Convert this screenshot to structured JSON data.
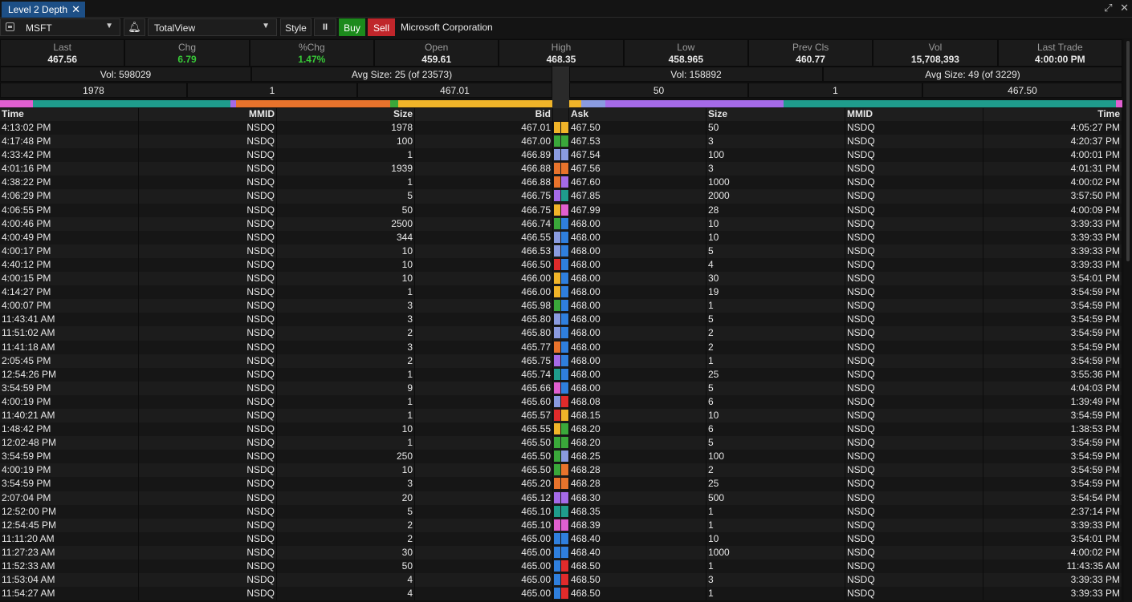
{
  "tab": {
    "title": "Level 2 Depth"
  },
  "toolbar": {
    "symbol": "MSFT",
    "view": "TotalView",
    "style": "Style",
    "pause": "II",
    "buy": "Buy",
    "sell": "Sell",
    "company": "Microsoft Corporation"
  },
  "summary": [
    {
      "label": "Last",
      "value": "467.56",
      "color": ""
    },
    {
      "label": "Chg",
      "value": "6.79",
      "color": "#37c837"
    },
    {
      "label": "%Chg",
      "value": "1.47%",
      "color": "#37c837"
    },
    {
      "label": "Open",
      "value": "459.61",
      "color": ""
    },
    {
      "label": "High",
      "value": "468.35",
      "color": ""
    },
    {
      "label": "Low",
      "value": "458.965",
      "color": ""
    },
    {
      "label": "Prev Cls",
      "value": "460.77",
      "color": ""
    },
    {
      "label": "Vol",
      "value": "15,708,393",
      "color": ""
    },
    {
      "label": "Last Trade",
      "value": "4:00:00 PM",
      "color": ""
    }
  ],
  "bid_side": {
    "vol": "Vol: 598029",
    "avg": "Avg Size: 25 (of 23573)",
    "top": [
      "1978",
      "1",
      "467.01"
    ]
  },
  "ask_side": {
    "vol": "Vol: 158892",
    "avg": "Avg Size: 49 (of 3229)",
    "top": [
      "50",
      "1",
      "467.50"
    ]
  },
  "colors": {
    "orange": "#e8732c",
    "yellow": "#f0b429",
    "green": "#3aa83a",
    "lav": "#8a9be0",
    "purple": "#a56ae8",
    "teal": "#1f9c8c",
    "pink": "#e05fd0",
    "blue": "#2f7fdd",
    "red": "#e02b2b"
  },
  "bid_bar": [
    [
      "pink",
      3
    ],
    [
      "teal",
      18
    ],
    [
      "purple",
      0.5
    ],
    [
      "orange",
      14
    ],
    [
      "green",
      0.8
    ],
    [
      "yellow",
      14
    ]
  ],
  "ask_bar": [
    [
      "yellow",
      1.5
    ],
    [
      "lav",
      3
    ],
    [
      "purple",
      22
    ],
    [
      "teal",
      41
    ],
    [
      "pink",
      0.8
    ]
  ],
  "headers": {
    "time": "Time",
    "mmid": "MMID",
    "size": "Size",
    "bid": "Bid",
    "ask": "Ask"
  },
  "bids": [
    [
      "4:13:02 PM",
      "NSDQ",
      "1978",
      "467.01",
      "yellow"
    ],
    [
      "4:17:48 PM",
      "NSDQ",
      "100",
      "467.00",
      "green"
    ],
    [
      "4:33:42 PM",
      "NSDQ",
      "1",
      "466.89",
      "lav"
    ],
    [
      "4:01:16 PM",
      "NSDQ",
      "1939",
      "466.88",
      "orange"
    ],
    [
      "4:38:22 PM",
      "NSDQ",
      "1",
      "466.88",
      "orange"
    ],
    [
      "4:06:29 PM",
      "NSDQ",
      "5",
      "466.75",
      "purple"
    ],
    [
      "4:06:55 PM",
      "NSDQ",
      "50",
      "466.75",
      "yellow"
    ],
    [
      "4:00:46 PM",
      "NSDQ",
      "2500",
      "466.74",
      "green"
    ],
    [
      "4:00:49 PM",
      "NSDQ",
      "344",
      "466.55",
      "lav"
    ],
    [
      "4:00:17 PM",
      "NSDQ",
      "10",
      "466.53",
      "lav"
    ],
    [
      "4:40:12 PM",
      "NSDQ",
      "10",
      "466.50",
      "red"
    ],
    [
      "4:00:15 PM",
      "NSDQ",
      "10",
      "466.00",
      "yellow"
    ],
    [
      "4:14:27 PM",
      "NSDQ",
      "1",
      "466.00",
      "yellow"
    ],
    [
      "4:00:07 PM",
      "NSDQ",
      "3",
      "465.98",
      "green"
    ],
    [
      "11:43:41 AM",
      "NSDQ",
      "3",
      "465.80",
      "lav"
    ],
    [
      "11:51:02 AM",
      "NSDQ",
      "2",
      "465.80",
      "lav"
    ],
    [
      "11:41:18 AM",
      "NSDQ",
      "3",
      "465.77",
      "orange"
    ],
    [
      "2:05:45 PM",
      "NSDQ",
      "2",
      "465.75",
      "purple"
    ],
    [
      "12:54:26 PM",
      "NSDQ",
      "1",
      "465.74",
      "teal"
    ],
    [
      "3:54:59 PM",
      "NSDQ",
      "9",
      "465.66",
      "pink"
    ],
    [
      "4:00:19 PM",
      "NSDQ",
      "1",
      "465.60",
      "lav"
    ],
    [
      "11:40:21 AM",
      "NSDQ",
      "1",
      "465.57",
      "red"
    ],
    [
      "1:48:42 PM",
      "NSDQ",
      "10",
      "465.55",
      "yellow"
    ],
    [
      "12:02:48 PM",
      "NSDQ",
      "1",
      "465.50",
      "green"
    ],
    [
      "3:54:59 PM",
      "NSDQ",
      "250",
      "465.50",
      "green"
    ],
    [
      "4:00:19 PM",
      "NSDQ",
      "10",
      "465.50",
      "green"
    ],
    [
      "3:54:59 PM",
      "NSDQ",
      "3",
      "465.20",
      "orange"
    ],
    [
      "2:07:04 PM",
      "NSDQ",
      "20",
      "465.12",
      "purple"
    ],
    [
      "12:52:00 PM",
      "NSDQ",
      "5",
      "465.10",
      "teal"
    ],
    [
      "12:54:45 PM",
      "NSDQ",
      "2",
      "465.10",
      "pink"
    ],
    [
      "11:11:20 AM",
      "NSDQ",
      "2",
      "465.00",
      "blue"
    ],
    [
      "11:27:23 AM",
      "NSDQ",
      "30",
      "465.00",
      "blue"
    ],
    [
      "11:52:33 AM",
      "NSDQ",
      "50",
      "465.00",
      "blue"
    ],
    [
      "11:53:04 AM",
      "NSDQ",
      "4",
      "465.00",
      "blue"
    ],
    [
      "11:54:27 AM",
      "NSDQ",
      "4",
      "465.00",
      "blue"
    ]
  ],
  "asks": [
    [
      "467.50",
      "50",
      "NSDQ",
      "4:05:27 PM",
      "yellow"
    ],
    [
      "467.53",
      "3",
      "NSDQ",
      "4:20:37 PM",
      "green"
    ],
    [
      "467.54",
      "100",
      "NSDQ",
      "4:00:01 PM",
      "lav"
    ],
    [
      "467.56",
      "3",
      "NSDQ",
      "4:01:31 PM",
      "orange"
    ],
    [
      "467.60",
      "1000",
      "NSDQ",
      "4:00:02 PM",
      "purple"
    ],
    [
      "467.85",
      "2000",
      "NSDQ",
      "3:57:50 PM",
      "teal"
    ],
    [
      "467.99",
      "28",
      "NSDQ",
      "4:00:09 PM",
      "pink"
    ],
    [
      "468.00",
      "10",
      "NSDQ",
      "3:39:33 PM",
      "blue"
    ],
    [
      "468.00",
      "10",
      "NSDQ",
      "3:39:33 PM",
      "blue"
    ],
    [
      "468.00",
      "5",
      "NSDQ",
      "3:39:33 PM",
      "blue"
    ],
    [
      "468.00",
      "4",
      "NSDQ",
      "3:39:33 PM",
      "blue"
    ],
    [
      "468.00",
      "30",
      "NSDQ",
      "3:54:01 PM",
      "blue"
    ],
    [
      "468.00",
      "19",
      "NSDQ",
      "3:54:59 PM",
      "blue"
    ],
    [
      "468.00",
      "1",
      "NSDQ",
      "3:54:59 PM",
      "blue"
    ],
    [
      "468.00",
      "5",
      "NSDQ",
      "3:54:59 PM",
      "blue"
    ],
    [
      "468.00",
      "2",
      "NSDQ",
      "3:54:59 PM",
      "blue"
    ],
    [
      "468.00",
      "2",
      "NSDQ",
      "3:54:59 PM",
      "blue"
    ],
    [
      "468.00",
      "1",
      "NSDQ",
      "3:54:59 PM",
      "blue"
    ],
    [
      "468.00",
      "25",
      "NSDQ",
      "3:55:36 PM",
      "blue"
    ],
    [
      "468.00",
      "5",
      "NSDQ",
      "4:04:03 PM",
      "blue"
    ],
    [
      "468.08",
      "6",
      "NSDQ",
      "1:39:49 PM",
      "red"
    ],
    [
      "468.15",
      "10",
      "NSDQ",
      "3:54:59 PM",
      "yellow"
    ],
    [
      "468.20",
      "6",
      "NSDQ",
      "1:38:53 PM",
      "green"
    ],
    [
      "468.20",
      "5",
      "NSDQ",
      "3:54:59 PM",
      "green"
    ],
    [
      "468.25",
      "100",
      "NSDQ",
      "3:54:59 PM",
      "lav"
    ],
    [
      "468.28",
      "2",
      "NSDQ",
      "3:54:59 PM",
      "orange"
    ],
    [
      "468.28",
      "25",
      "NSDQ",
      "3:54:59 PM",
      "orange"
    ],
    [
      "468.30",
      "500",
      "NSDQ",
      "3:54:54 PM",
      "purple"
    ],
    [
      "468.35",
      "1",
      "NSDQ",
      "2:37:14 PM",
      "teal"
    ],
    [
      "468.39",
      "1",
      "NSDQ",
      "3:39:33 PM",
      "pink"
    ],
    [
      "468.40",
      "10",
      "NSDQ",
      "3:54:01 PM",
      "blue"
    ],
    [
      "468.40",
      "1000",
      "NSDQ",
      "4:00:02 PM",
      "blue"
    ],
    [
      "468.50",
      "1",
      "NSDQ",
      "11:43:35 AM",
      "red"
    ],
    [
      "468.50",
      "3",
      "NSDQ",
      "3:39:33 PM",
      "red"
    ],
    [
      "468.50",
      "1",
      "NSDQ",
      "3:39:33 PM",
      "red"
    ]
  ]
}
